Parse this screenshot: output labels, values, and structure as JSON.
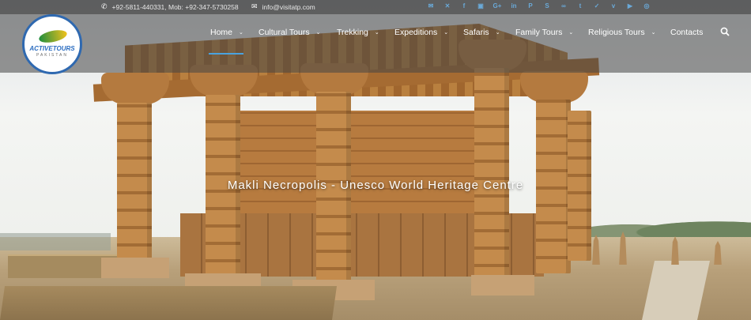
{
  "topbar": {
    "phone": "+92-5811-440331, Mob: +92-347-5730258",
    "email": "info@visitatp.com",
    "phone_icon": "phone-icon",
    "email_icon": "envelope-icon",
    "socials": [
      "email-icon",
      "cross-icon",
      "facebook-icon",
      "square-icon",
      "google-plus-icon",
      "linkedin-icon",
      "pinterest-icon",
      "skype-icon",
      "tripadvisor-icon",
      "tumblr-icon",
      "twitter-icon",
      "vimeo-icon",
      "youtube-icon",
      "instagram-icon"
    ]
  },
  "logo": {
    "name": "ACTIVETOURS",
    "sub": "PAKISTAN"
  },
  "nav": {
    "items": [
      {
        "label": "Home",
        "dropdown": true
      },
      {
        "label": "Cultural Tours",
        "dropdown": true
      },
      {
        "label": "Trekking",
        "dropdown": true
      },
      {
        "label": "Expeditions",
        "dropdown": true
      },
      {
        "label": "Safaris",
        "dropdown": true
      },
      {
        "label": "Family Tours",
        "dropdown": true
      },
      {
        "label": "Religious Tours",
        "dropdown": true
      },
      {
        "label": "Contacts",
        "dropdown": false
      }
    ],
    "active": "Home",
    "search_icon": "search-icon",
    "accent": "#4aa3df"
  },
  "hero": {
    "caption": "Makli Necropolis - Unesco World Heritage Centre"
  }
}
